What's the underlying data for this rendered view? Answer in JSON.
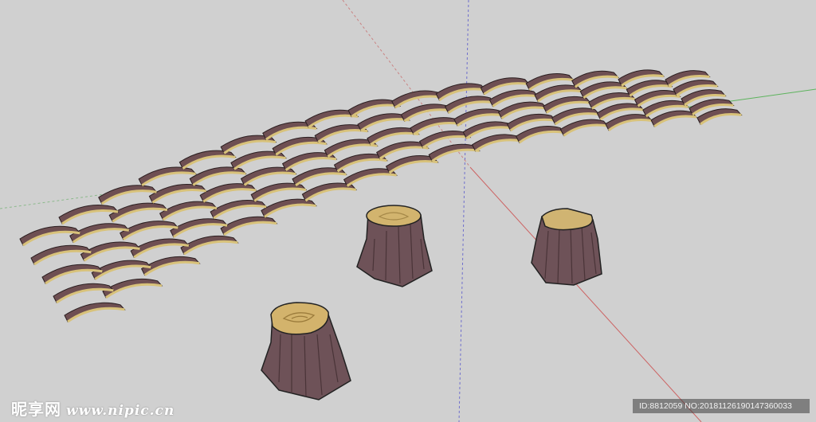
{
  "scene": {
    "description_tag": "3D model render",
    "colors": {
      "background": "#d0d0d0",
      "bark": "#6e4f52",
      "wood_edge": "#d8c27a",
      "stump_top": "#c9ab6a",
      "axis_red": "#d06060",
      "axis_green": "#5fb55f",
      "axis_blue": "#5555cc"
    }
  },
  "watermark": {
    "logo_text": "昵享网",
    "url": "www.nipic.cn",
    "id_text": "ID:8812059 NO:20181126190147360033"
  }
}
